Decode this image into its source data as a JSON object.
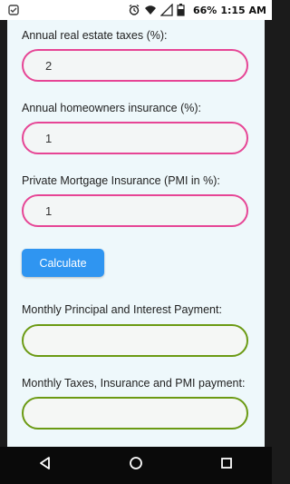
{
  "status_bar": {
    "battery": "66%",
    "time": "1:15 AM"
  },
  "form": {
    "taxes_label": "Annual real estate taxes (%):",
    "taxes_value": "2",
    "insurance_label": "Annual homeowners insurance (%):",
    "insurance_value": "1",
    "pmi_label": "Private Mortgage Insurance (PMI in %):",
    "pmi_value": "1",
    "calculate_label": "Calculate"
  },
  "results": {
    "principal_interest_label": "Monthly Principal and Interest Payment:",
    "principal_interest_value": "",
    "taxes_insurance_pmi_label": "Monthly Taxes, Insurance and PMI payment:",
    "taxes_insurance_pmi_value": ""
  },
  "colors": {
    "input_border": "#e64595",
    "output_border": "#6b9a13",
    "button": "#2f95f1",
    "background": "#eef8fb"
  },
  "icons": {
    "status": [
      "android-notification-icon",
      "alarm-icon",
      "wifi-icon",
      "signal-icon",
      "battery-icon"
    ],
    "nav": [
      "back-icon",
      "home-icon",
      "recents-icon"
    ]
  }
}
